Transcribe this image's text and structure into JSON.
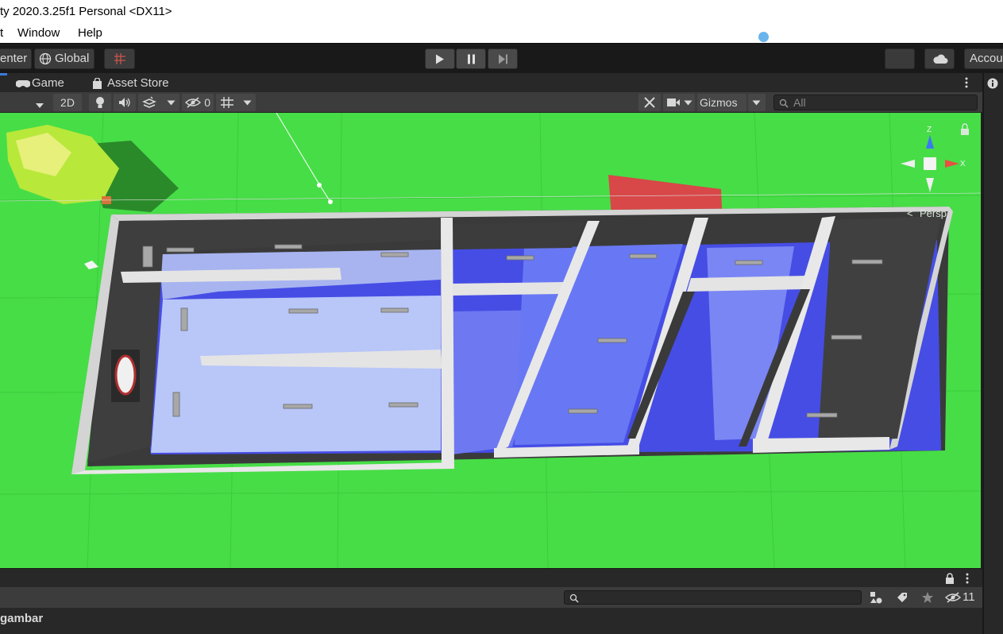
{
  "window": {
    "title": "ty 2020.3.25f1 Personal <DX11>"
  },
  "menu": {
    "items": [
      "t",
      "Window",
      "Help"
    ]
  },
  "toolbar": {
    "pivot_label": "enter",
    "space_label": "Global",
    "account_label": "Accou"
  },
  "tabs": [
    {
      "label": "Game"
    },
    {
      "label": "Asset Store"
    }
  ],
  "scene_toolbar": {
    "mode_2d": "2D",
    "hidden_count": "0",
    "gizmos_label": "Gizmos",
    "search_placeholder": "All"
  },
  "scene": {
    "projection_label": "Persp",
    "axis_y": "Z",
    "axis_x": "X"
  },
  "bottom": {
    "hidden_count": "11",
    "project_label": "gambar"
  },
  "colors": {
    "ground": "#47dd47",
    "water": "#4850f8",
    "wall": "#d0d0d0",
    "dark_ui": "#282828",
    "accent_blue": "#6ab4ec"
  }
}
